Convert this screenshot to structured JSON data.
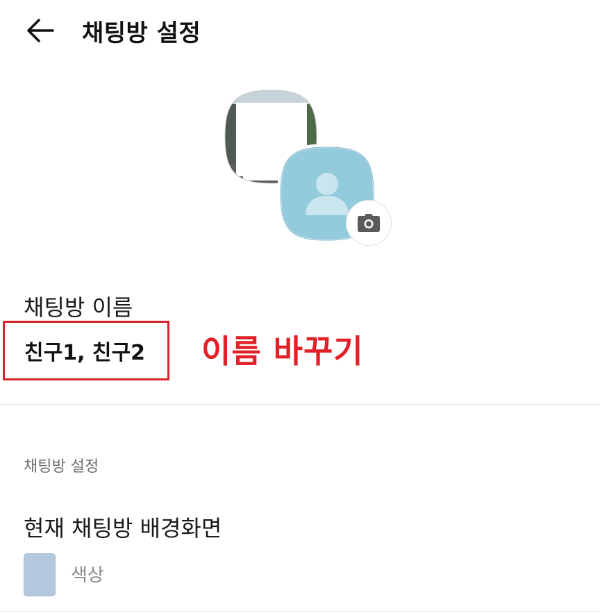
{
  "header": {
    "back_icon": "arrow-left-icon",
    "title": "채팅방 설정"
  },
  "avatar": {
    "back_image": "blurred-profile-photo",
    "front_icon": "person-silhouette-icon",
    "front_color": "#93cbdc",
    "camera_icon": "camera-icon"
  },
  "room_name": {
    "label": "채팅방 이름",
    "value": "친구1, 친구2",
    "annotation": "이름 바꾸기",
    "annotation_color": "#e12028"
  },
  "settings": {
    "section_header": "채팅방 설정",
    "background_title": "현재 채팅방 배경화면",
    "background_type": "색상",
    "background_color": "#b3c8dc"
  }
}
